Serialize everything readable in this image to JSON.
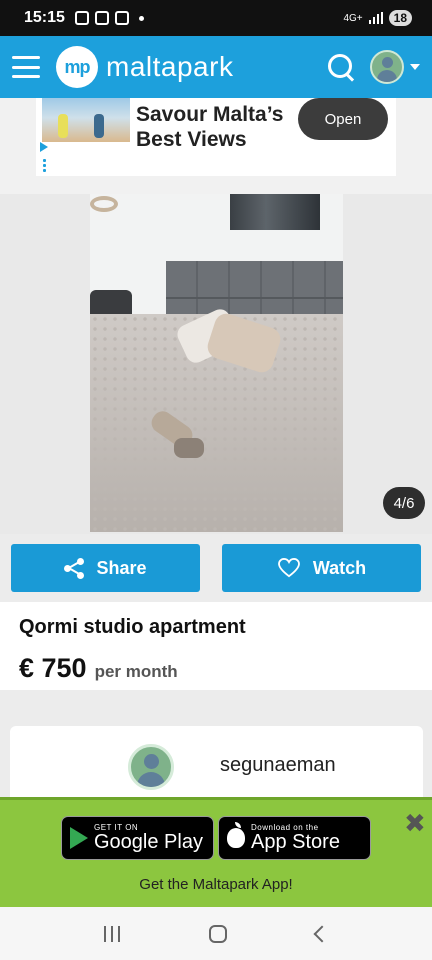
{
  "status_bar": {
    "time": "15:15",
    "network": "4G+",
    "battery": "18"
  },
  "header": {
    "logo_mark": "mp",
    "logo_text": "maltapark"
  },
  "ad": {
    "headline": "Savour Malta’s Best Views",
    "cta": "Open"
  },
  "gallery": {
    "counter": "4/6"
  },
  "actions": {
    "share_label": "Share",
    "watch_label": "Watch"
  },
  "listing": {
    "title": "Qormi studio apartment",
    "price": "€ 750",
    "price_unit": "per month"
  },
  "seller": {
    "name": "segunaeman"
  },
  "app_promo": {
    "google_small": "GET IT ON",
    "google_big": "Google Play",
    "apple_small": "Download on the",
    "apple_big": "App Store",
    "text": "Get the Maltapark App!",
    "close": "✖"
  },
  "colors": {
    "brand_blue": "#1da0dc",
    "button_blue": "#1a9ad6",
    "promo_green": "#8cc63f"
  }
}
